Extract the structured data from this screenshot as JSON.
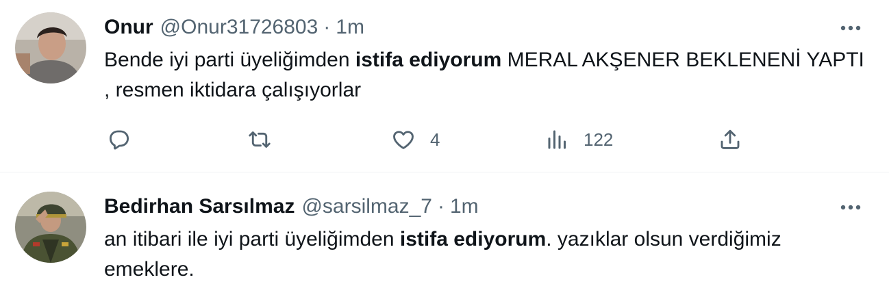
{
  "tweets": [
    {
      "name": "Onur",
      "handle": "@Onur31726803",
      "separator": "·",
      "time": "1m",
      "text_before": "Bende iyi parti üyeliğimden ",
      "text_bold": "istifa ediyorum",
      "text_after": " MERAL AKŞENER BEKLENENİ YAPTI , resmen iktidara çalışıyorlar",
      "likes": "4",
      "views": "122"
    },
    {
      "name": "Bedirhan Sarsılmaz",
      "handle": "@sarsilmaz_7",
      "separator": "·",
      "time": "1m",
      "text_before": "an itibari ile iyi parti üyeliğimden ",
      "text_bold": "istifa ediyorum",
      "text_after": ". yazıklar olsun verdiğimiz emeklere."
    }
  ],
  "icons": {
    "more": "more-horizontal-icon",
    "reply": "reply-icon",
    "retweet": "retweet-icon",
    "like": "heart-icon",
    "views": "views-icon",
    "share": "share-icon"
  },
  "colors": {
    "text": "#0f1419",
    "secondary": "#536471",
    "divider": "#eff3f4"
  }
}
